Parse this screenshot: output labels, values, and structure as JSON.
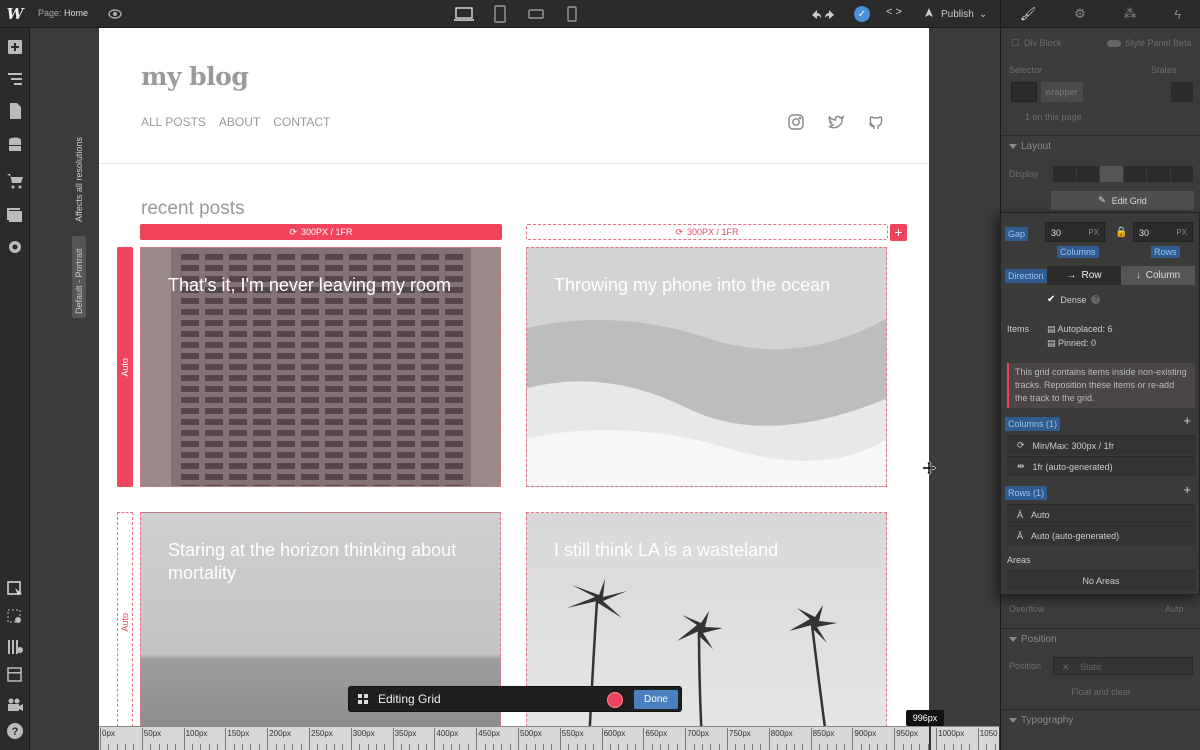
{
  "topbar": {
    "logo": "W",
    "page_prefix": "Page:",
    "page_name": "Home",
    "publish_label": "Publish",
    "code_label": "< >"
  },
  "sidebar": {
    "vertical_tabs": [
      "Affects all resolutions",
      "Default - Portrait"
    ]
  },
  "site": {
    "title": "my blog",
    "nav": [
      "ALL POSTS",
      "ABOUT",
      "CONTACT"
    ],
    "section_heading": "recent posts",
    "column_bar_labels": [
      "300PX / 1FR",
      "300PX / 1FR"
    ],
    "row_labels": [
      "Auto",
      "Auto"
    ],
    "posts": [
      {
        "title": "That's it, I'm never leaving my room"
      },
      {
        "title": "Throwing my phone into the ocean"
      },
      {
        "title": "Staring at the horizon thinking about mortality"
      },
      {
        "title": "I still think LA is a wasteland"
      }
    ]
  },
  "editing_bar": {
    "label": "Editing Grid",
    "done_label": "Done"
  },
  "ruler": {
    "labels": [
      "0px",
      "50px",
      "100px",
      "150px",
      "200px",
      "250px",
      "300px",
      "350px",
      "400px",
      "450px",
      "500px",
      "550px",
      "600px",
      "650px",
      "700px",
      "750px",
      "800px",
      "850px",
      "900px",
      "950px",
      "1000px",
      "1050"
    ],
    "width_tooltip": "996px"
  },
  "right_panel": {
    "element_type": "Div Block",
    "style_panel_label": "Style Panel Beta",
    "selector_label": "Selector",
    "states_label": "States",
    "selector_class": "wrapper",
    "on_page": "1 on this page",
    "layout_heading": "Layout",
    "display_label": "Display",
    "edit_grid_label": "Edit Grid",
    "overflow_label": "Overflow",
    "overflow_value": "Auto",
    "position_heading": "Position",
    "position_label": "Position",
    "position_value": "Static",
    "float_clear_label": "Float and clear",
    "typography_heading": "Typography"
  },
  "grid_popup": {
    "gap_label": "Gap",
    "gap_columns": "30",
    "gap_rows": "30",
    "unit": "PX",
    "columns_caption": "Columns",
    "rows_caption": "Rows",
    "direction_label": "Direction",
    "direction_row": "Row",
    "direction_column": "Column",
    "dense_label": "Dense",
    "items_label": "Items",
    "autoplaced": "Autoplaced: 6",
    "pinned": "Pinned: 0",
    "warning": "This grid contains items inside non-existing tracks. Reposition these items or re-add the track to the grid.",
    "columns_heading": "Columns (1)",
    "columns": [
      {
        "icon": "minmax-icon",
        "label": "Min/Max: 300px / 1fr"
      },
      {
        "icon": "fr-icon",
        "label": "1fr (auto-generated)"
      }
    ],
    "rows_heading": "Rows (1)",
    "rows": [
      {
        "icon": "auto-icon",
        "label": "Auto"
      },
      {
        "icon": "auto-icon",
        "label": "Auto (auto-generated)"
      }
    ],
    "areas_label": "Areas",
    "no_areas": "No Areas"
  },
  "colors": {
    "accent_red": "#f0435c",
    "accent_blue": "#4a90d9",
    "panel_bg": "#3b3b3b",
    "bar_bg": "#2b2b2b"
  }
}
